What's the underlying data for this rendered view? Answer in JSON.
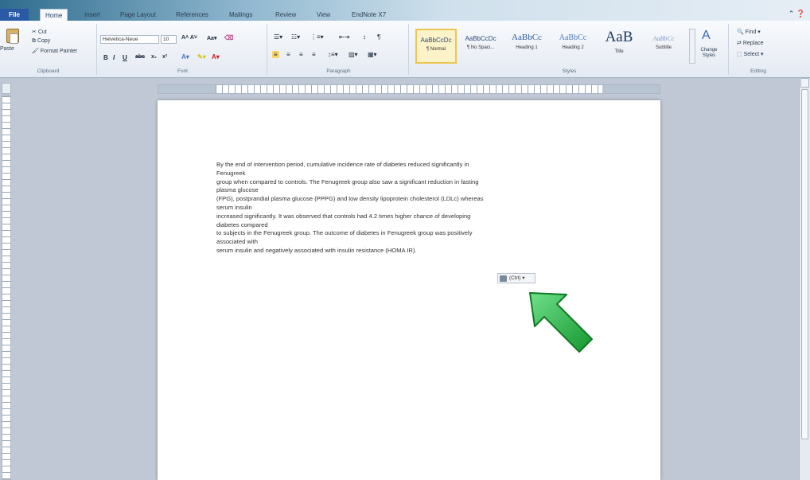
{
  "tabs": [
    {
      "label": "File"
    },
    {
      "label": "Home"
    },
    {
      "label": "Insert"
    },
    {
      "label": "Page Layout"
    },
    {
      "label": "References"
    },
    {
      "label": "Mailings"
    },
    {
      "label": "Review"
    },
    {
      "label": "View"
    },
    {
      "label": "EndNote X7"
    }
  ],
  "ribbon": {
    "clipboard": {
      "paste": "Paste",
      "cut": "Cut",
      "copy": "Copy",
      "format_painter": "Format Painter",
      "label": "Clipboard"
    },
    "font": {
      "name": "Helvetica-Neue",
      "size": "10",
      "label": "Font"
    },
    "paragraph": {
      "label": "Paragraph"
    },
    "styles": {
      "label": "Styles",
      "change_styles": "Change Styles",
      "items": [
        {
          "sample": "AaBbCcDc",
          "name": "¶ Normal"
        },
        {
          "sample": "AaBbCcDc",
          "name": "¶ No Spaci..."
        },
        {
          "sample": "AaBbCc",
          "name": "Heading 1"
        },
        {
          "sample": "AaBbCc",
          "name": "Heading 2"
        },
        {
          "sample": "AaB",
          "name": "Title"
        },
        {
          "sample": "AaBbCc",
          "name": "Subtitle"
        }
      ]
    },
    "editing": {
      "find": "Find",
      "replace": "Replace",
      "select": "Select",
      "label": "Editing"
    }
  },
  "document": {
    "lines": [
      "By the  end of intervention period, cumulative incidence rate  of diabetes reduced significantly in",
      "Fenugreek",
      "group when  compared to controls. The Fenugreek  group also saw  a significant reduction in fasting",
      "plasma glucose",
      "(FPG),  postprandial plasma glucose (PPPG) and low density lipoprotein cholesterol (LDLc) whereas",
      "serum insulin",
      "increased  significantly. It was observed that controls had 4.2  times higher chance  of developing",
      "diabetes compared",
      "to subjects in the Fenugreek  group. The  outcome of diabetes in Fenugreek  group was positively",
      "associated with",
      "serum insulin and negatively associated with insulin resistance (HOMA IR)."
    ],
    "paste_options": "(Ctrl) ▾"
  },
  "colors": {
    "accent": "#2a5aa6",
    "arrow": "#22b04a"
  }
}
